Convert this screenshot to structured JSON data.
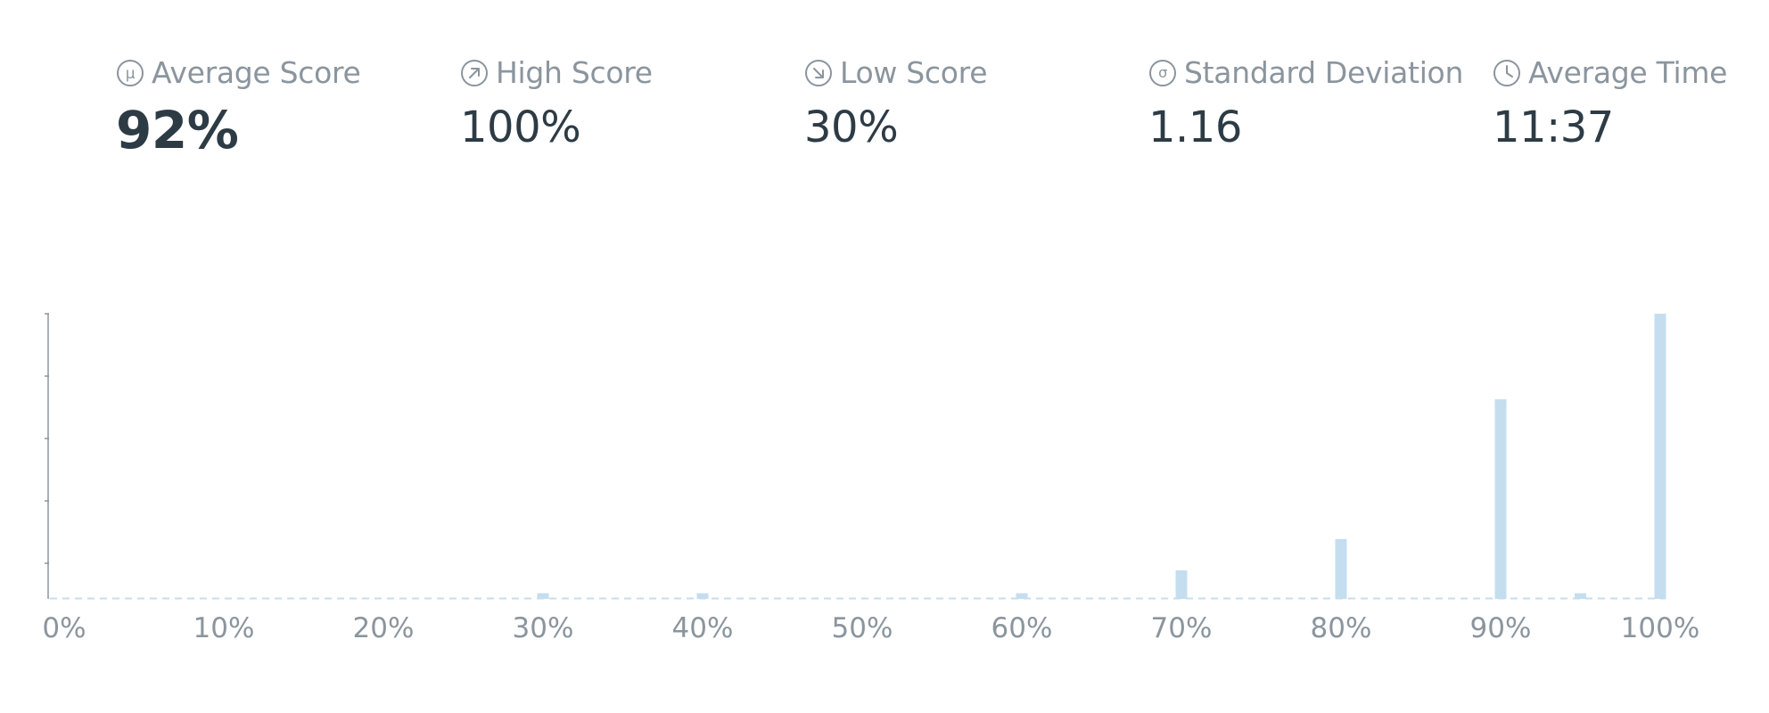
{
  "stats": [
    {
      "icon": "mu-icon",
      "label": "Average Score",
      "value": "92%"
    },
    {
      "icon": "arrow-up-right-icon",
      "label": "High Score",
      "value": "100%"
    },
    {
      "icon": "arrow-down-right-icon",
      "label": "Low Score",
      "value": "30%"
    },
    {
      "icon": "sigma-icon",
      "label": "Standard Deviation",
      "value": "1.16"
    },
    {
      "icon": "clock-icon",
      "label": "Average Time",
      "value": "11:37"
    }
  ],
  "colors": {
    "bar": "#c4def0",
    "baseline": "#c4def0",
    "axis": "#8b959e",
    "label": "#8b959e",
    "value": "#2d3b45"
  },
  "chart_data": {
    "type": "bar",
    "title": "",
    "xlabel": "",
    "ylabel": "",
    "xlim": [
      0,
      100
    ],
    "ylim": [
      0,
      100
    ],
    "x_ticks": [
      0,
      10,
      20,
      30,
      40,
      50,
      60,
      70,
      80,
      90,
      100
    ],
    "x_tick_labels": [
      "0%",
      "10%",
      "20%",
      "30%",
      "40%",
      "50%",
      "60%",
      "70%",
      "80%",
      "90%",
      "100%"
    ],
    "y_tick_count": 5,
    "bins": [
      {
        "x": 30,
        "value": 2
      },
      {
        "x": 40,
        "value": 2
      },
      {
        "x": 60,
        "value": 2
      },
      {
        "x": 70,
        "value": 10
      },
      {
        "x": 80,
        "value": 21
      },
      {
        "x": 90,
        "value": 70
      },
      {
        "x": 95,
        "value": 2
      },
      {
        "x": 100,
        "value": 100
      }
    ],
    "grid": false,
    "legend": "none"
  }
}
